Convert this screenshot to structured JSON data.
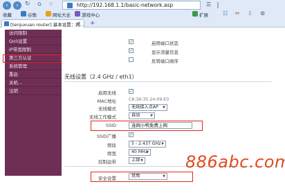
{
  "browser": {
    "address": "http://192.168.1.1/basic-network.asp",
    "bookmarks": [
      "收藏",
      "谷歌",
      "网址大全",
      "游戏中心"
    ],
    "extensions_label": "扩展",
    "tab_title": "[tenjuxuan router] 基本设置：网...",
    "colors": {
      "chrome": "#dfe9f7",
      "accent": "#3c7bc2"
    }
  },
  "sidebar": {
    "items": [
      "访问限制",
      "QoS设置",
      "IP带宽限制",
      "第三方认证",
      "系统管理",
      "重启",
      "关机...",
      "注销"
    ],
    "highlighted": "第三方认证",
    "color": "#6f2f55"
  },
  "main": {
    "top_options": [
      {
        "label": "启用端口状态",
        "checked": true
      },
      {
        "label": "显示流量信息",
        "checked": true
      },
      {
        "label": "反转端口顺序",
        "checked": false
      }
    ],
    "wireless_section_title": "无线设置（2.4 GHz / eth1）",
    "fields": {
      "enable_wireless": {
        "label": "启用无线",
        "checked": true
      },
      "mac": {
        "label": "MAC地址",
        "value": "C8:3A:35:24:09:E0"
      },
      "wireless_mode": {
        "label": "无线模式",
        "value": "无线接入点AP"
      },
      "network_mode": {
        "label": "无线工作模式",
        "value": "自动"
      },
      "ssid": {
        "label": "SSID",
        "value": "连网小鸭免费上网"
      },
      "ssid_broadcast": {
        "label": "SSID广播",
        "checked": true
      },
      "channel": {
        "label": "频段",
        "value": "5 - 2.437 GHz"
      },
      "width": {
        "label": "频宽",
        "value": "40 MHz"
      },
      "sideband": {
        "label": "控制边带",
        "value": "上部"
      },
      "security": {
        "label": "安全设置",
        "value": "禁用"
      }
    }
  },
  "watermark": "886abc.com"
}
